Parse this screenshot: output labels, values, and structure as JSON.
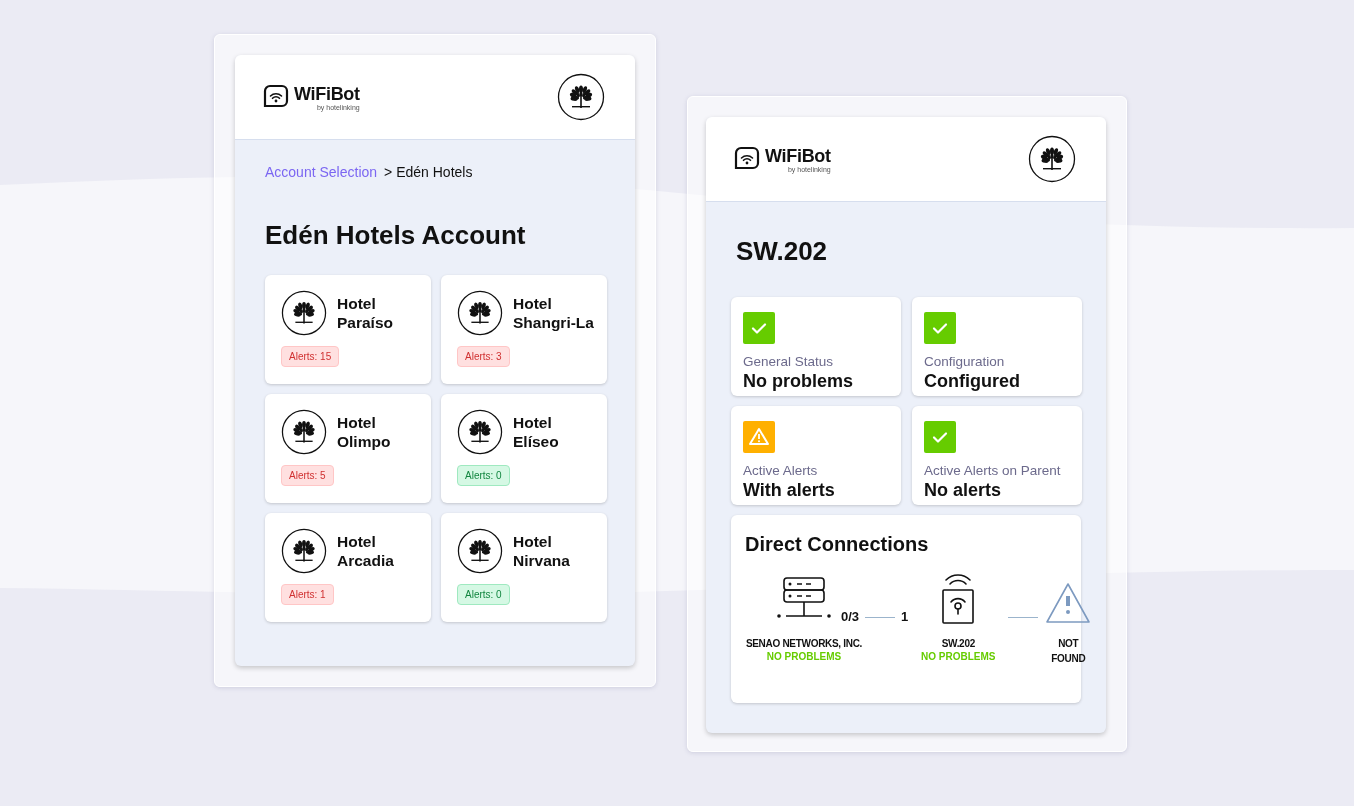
{
  "account_panel": {
    "header": {
      "logo": {
        "name": "WiFiBot",
        "byline": "by hotelinking"
      }
    },
    "breadcrumb": {
      "link": "Account Selection",
      "current": "> Edén Hotels"
    },
    "title": "Edén Hotels Account",
    "hotels": [
      {
        "name": "Hotel Paraíso",
        "alerts": {
          "text": "Alerts: 15",
          "kind": "alert"
        }
      },
      {
        "name": "Hotel Shangri-La",
        "alerts": {
          "text": "Alerts: 3",
          "kind": "alert"
        }
      },
      {
        "name": "Hotel Olimpo",
        "alerts": {
          "text": "Alerts: 5",
          "kind": "alert"
        }
      },
      {
        "name": "Hotel Elíseo",
        "alerts": {
          "text": "Alerts: 0",
          "kind": "ok"
        }
      },
      {
        "name": "Hotel Arcadia",
        "alerts": {
          "text": "Alerts: 1",
          "kind": "alert"
        }
      },
      {
        "name": "Hotel Nirvana",
        "alerts": {
          "text": "Alerts: 0",
          "kind": "ok"
        }
      }
    ]
  },
  "device_panel": {
    "header": {
      "logo": {
        "name": "WiFiBot",
        "byline": "by hotelinking"
      }
    },
    "title": "SW.202",
    "status_tiles": [
      {
        "kind": "ok",
        "label": "General Status",
        "value": "No problems"
      },
      {
        "kind": "ok",
        "label": "Configuration",
        "value": "Configured"
      },
      {
        "kind": "warning",
        "label": "Active Alerts",
        "value": "With alerts"
      },
      {
        "kind": "ok",
        "label": "Active Alerts on Parent",
        "value": "No alerts"
      }
    ],
    "direct_connections": {
      "title": "Direct Connections",
      "nodes": [
        {
          "kind": "server",
          "name": "SENAO NETWORKS, INC.",
          "status": "NO PROBLEMS"
        },
        {
          "kind": "access-point",
          "name": "SW.202",
          "status": "NO PROBLEMS"
        },
        {
          "kind": "unknown",
          "name": "NOT FOUND"
        }
      ],
      "links": [
        {
          "from_port": "0/3",
          "to_port": "1"
        }
      ]
    }
  }
}
